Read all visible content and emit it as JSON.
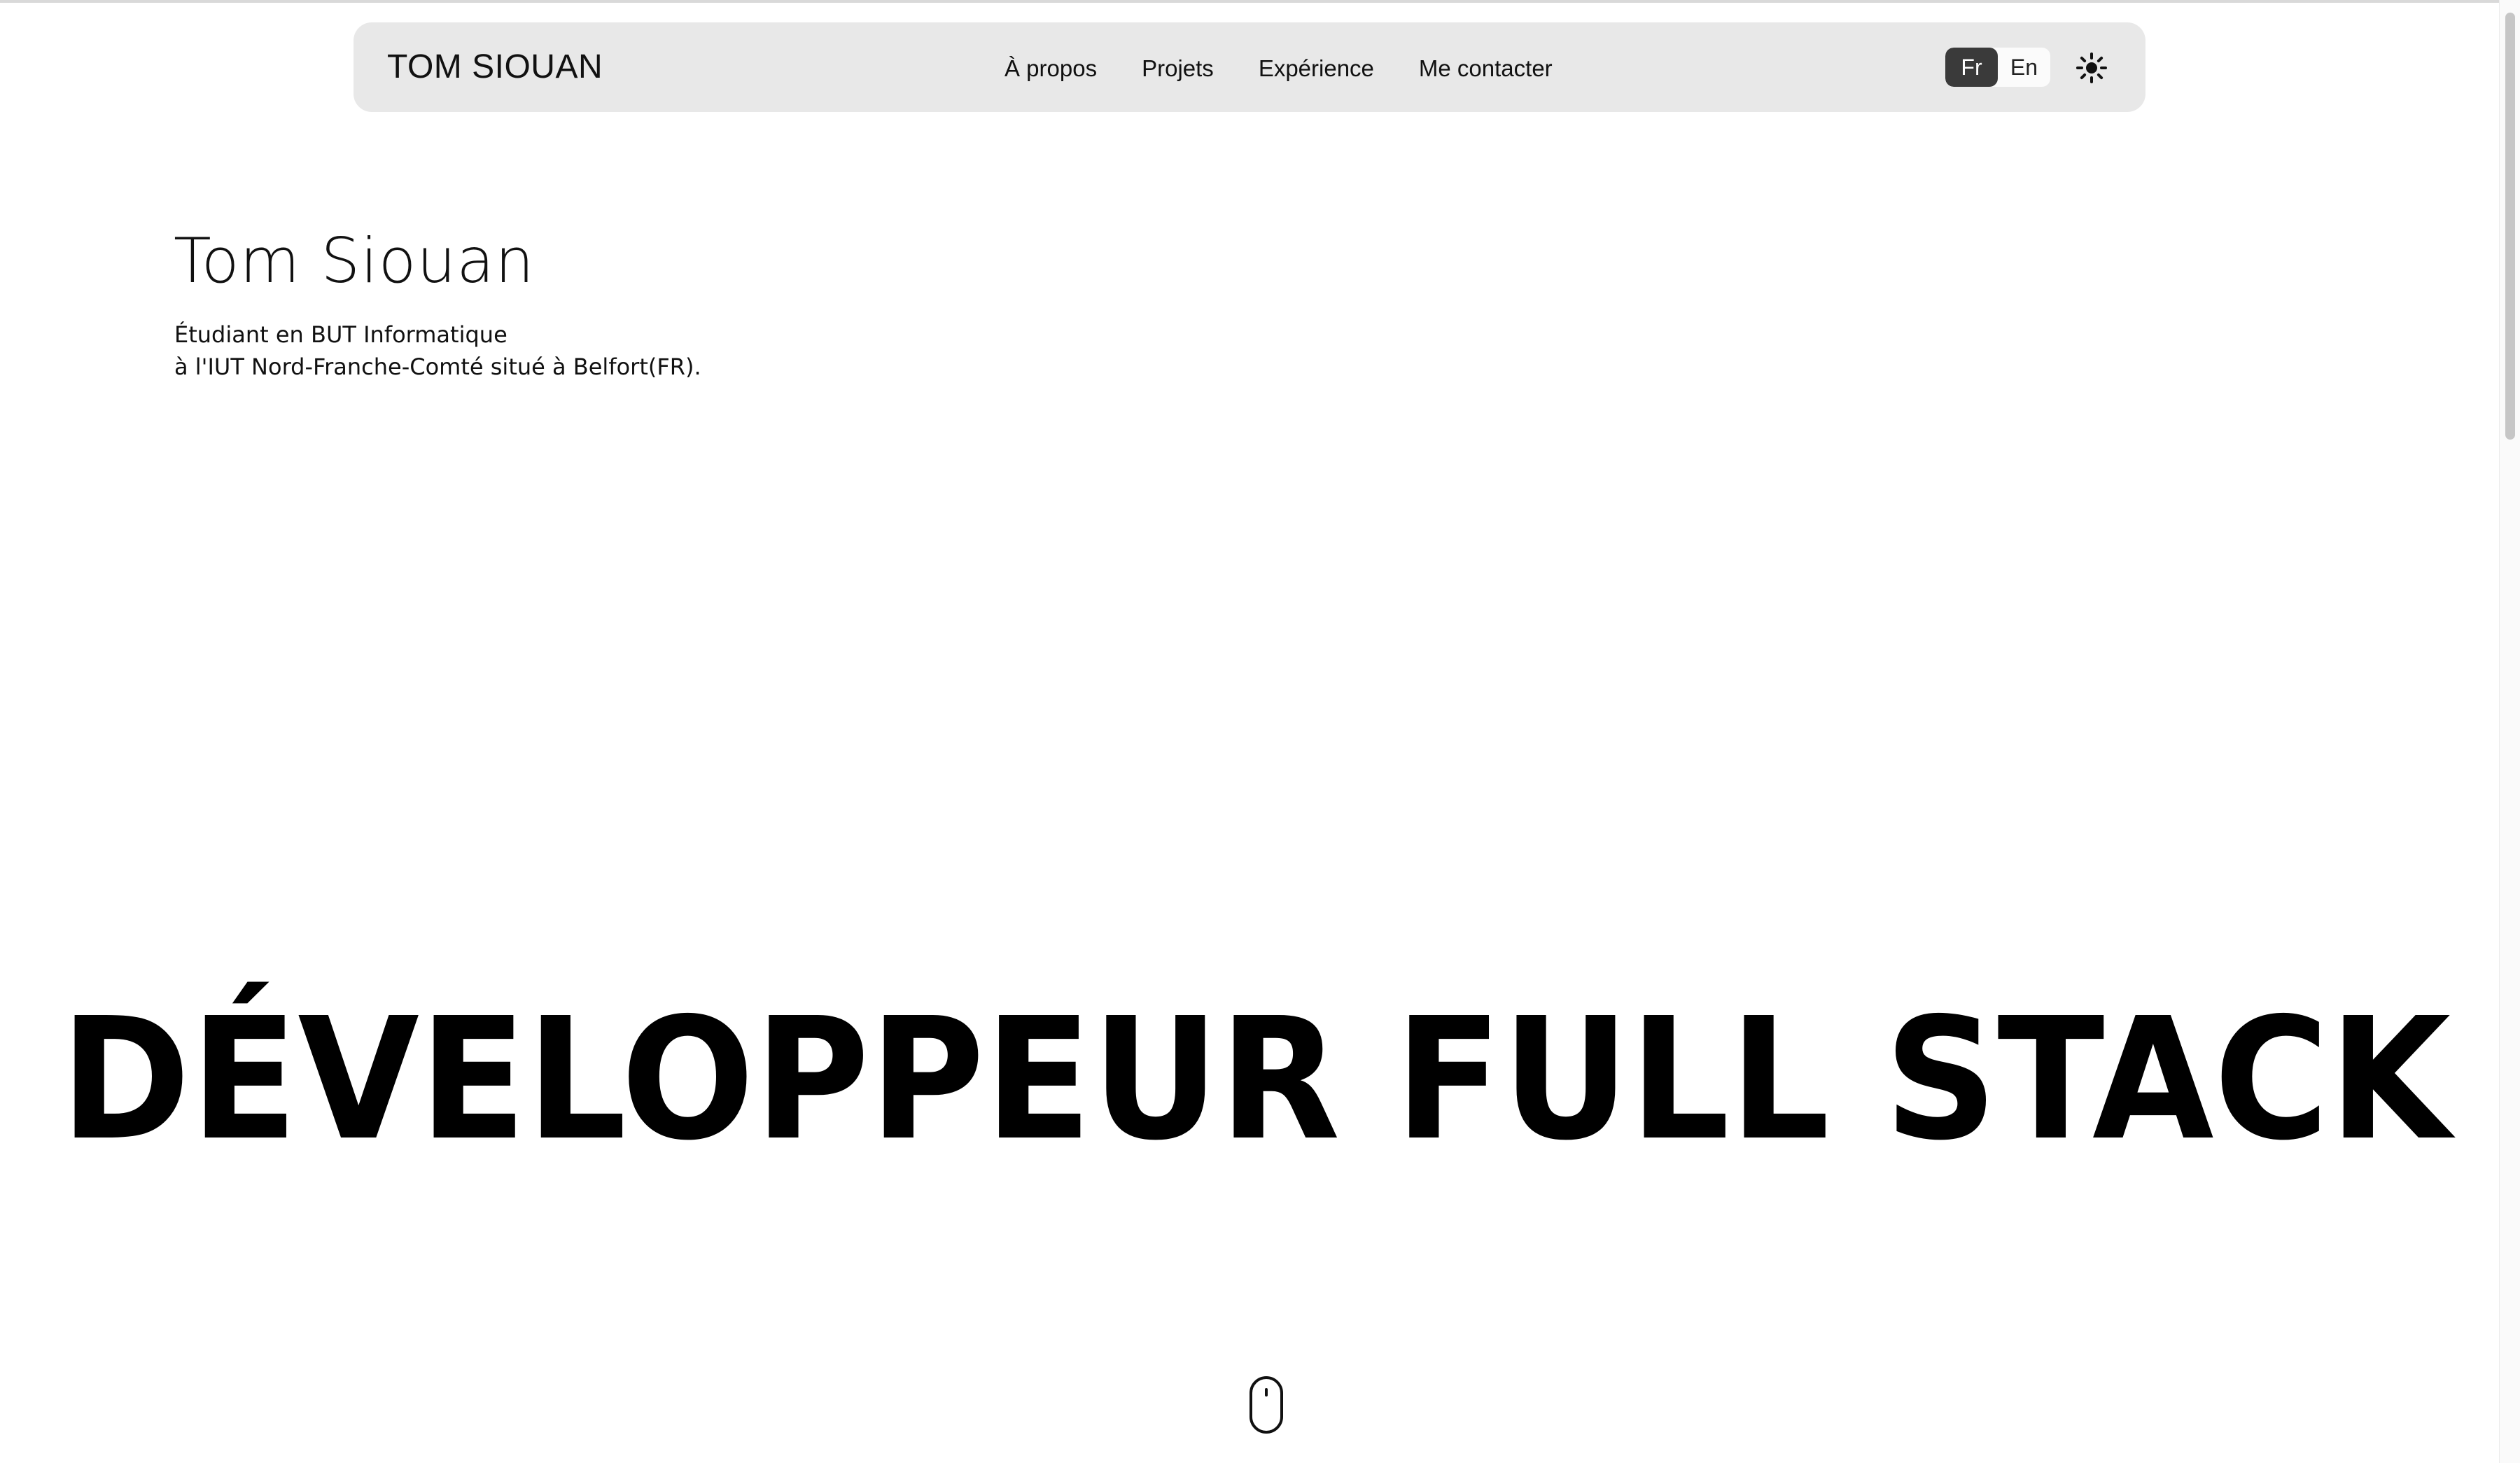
{
  "navbar": {
    "brand": "TOM SIOUAN",
    "links": [
      "À propos",
      "Projets",
      "Expérience",
      "Me contacter"
    ],
    "languages": [
      "Fr",
      "En"
    ],
    "active_language": "Fr",
    "theme_icon": "sun-icon"
  },
  "hero": {
    "name": "Tom Siouan",
    "description_line1": "Étudiant en BUT Informatique",
    "description_line2": "à l'IUT Nord-Franche-Comté situé à Belfort(FR).",
    "headline": "DÉVELOPPEUR FULL STACK"
  },
  "scroll_indicator_icon": "mouse-icon",
  "colors": {
    "navbar_bg": "#e8e8e8",
    "active_lang_bg": "#3a3a3a",
    "text": "#111111",
    "background": "#ffffff"
  }
}
